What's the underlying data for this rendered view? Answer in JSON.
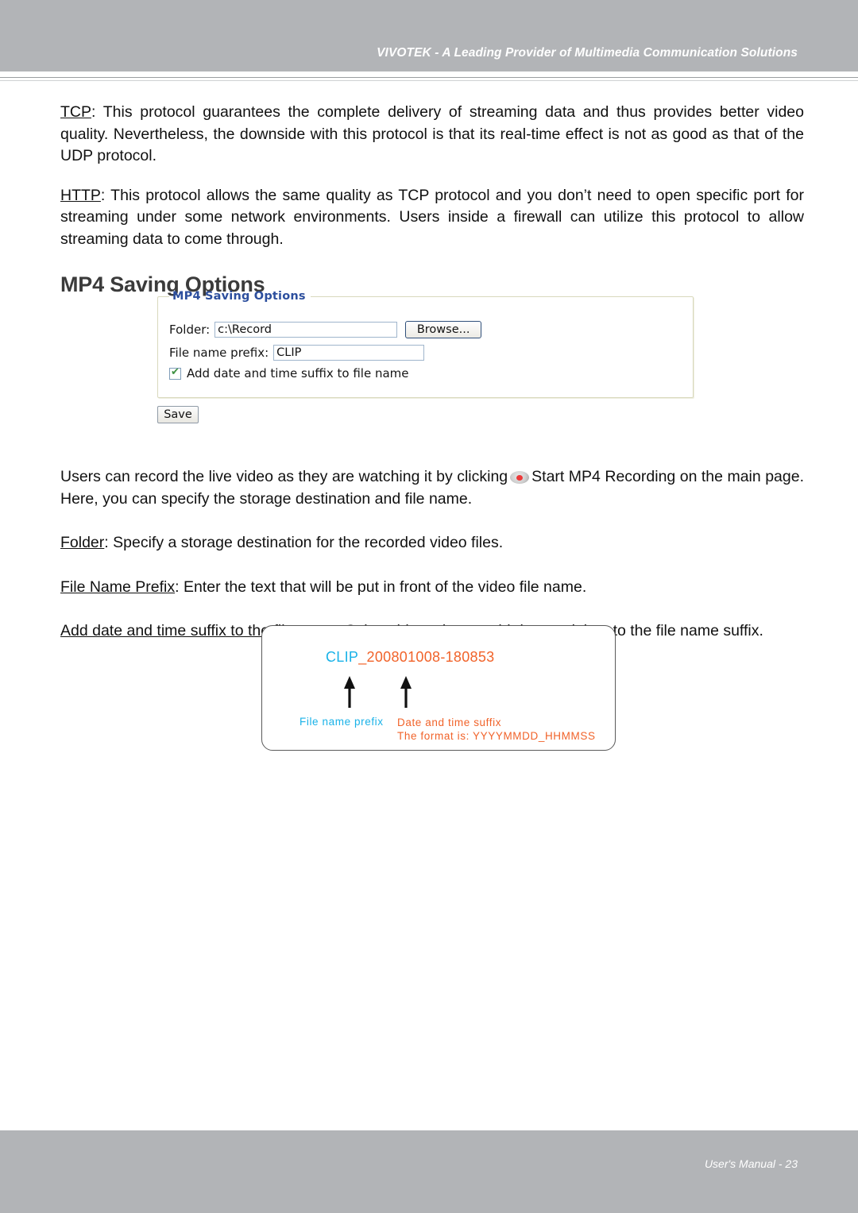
{
  "header": {
    "title": "VIVOTEK - A Leading Provider of Multimedia Communication Solutions"
  },
  "footer": {
    "title": "User's Manual - 23"
  },
  "content": {
    "paragraph_tcp_term": "TCP",
    "paragraph_tcp_body": ": This protocol guarantees the complete delivery of streaming data and thus provides better video quality. Nevertheless, the downside with this protocol is that its real-time effect is not as good as that of the UDP protocol.",
    "paragraph_http_term": "HTTP",
    "paragraph_http_body": ": This protocol allows the same quality as TCP protocol and you don’t need to open specific port for streaming under some network environments. Users inside a firewall can utilize this protocol to allow streaming data to come through.",
    "section_heading": "MP4 Saving Options",
    "paragraph_record_pre": "Users can record the live video as they are watching it by clicking",
    "paragraph_record_post": "Start MP4 Recording on the main page. Here, you can specify the storage destination and file name.",
    "definition_folder_term": "Folder",
    "definition_folder_body": ": Specify a storage destination for the recorded video files.",
    "definition_prefix_term": "File Name Prefix",
    "definition_prefix_body": ": Enter the text that will be put in front of the video file name.",
    "definition_suffix_term": "Add date and time suffix to the file name",
    "definition_suffix_body": ": Select this option to add date and time to the file name suffix."
  },
  "widget": {
    "legend": "MP4 Saving Options",
    "folder_label": "Folder:",
    "folder_value": "c:\\Record",
    "browse_label": "Browse...",
    "prefix_label": "File name prefix:",
    "prefix_value": "CLIP",
    "checkbox_label": "Add date and time suffix to file name",
    "checkbox_checked": true,
    "checkbox_tick": "✔",
    "save_label": "Save",
    "legend_color": "#2d4f9e",
    "border_color": "#d9d9bd"
  },
  "diagram": {
    "filename_prefix": "CLIP",
    "filename_suffix": "_200801008-180853",
    "caption_prefix": "File name prefix",
    "caption_suffix_line1": "Date and time suffix",
    "caption_suffix_line2": "The format is: YYYYMMDD_HHMMSS",
    "prefix_color": "#19b2e8",
    "suffix_color": "#f1632a"
  }
}
